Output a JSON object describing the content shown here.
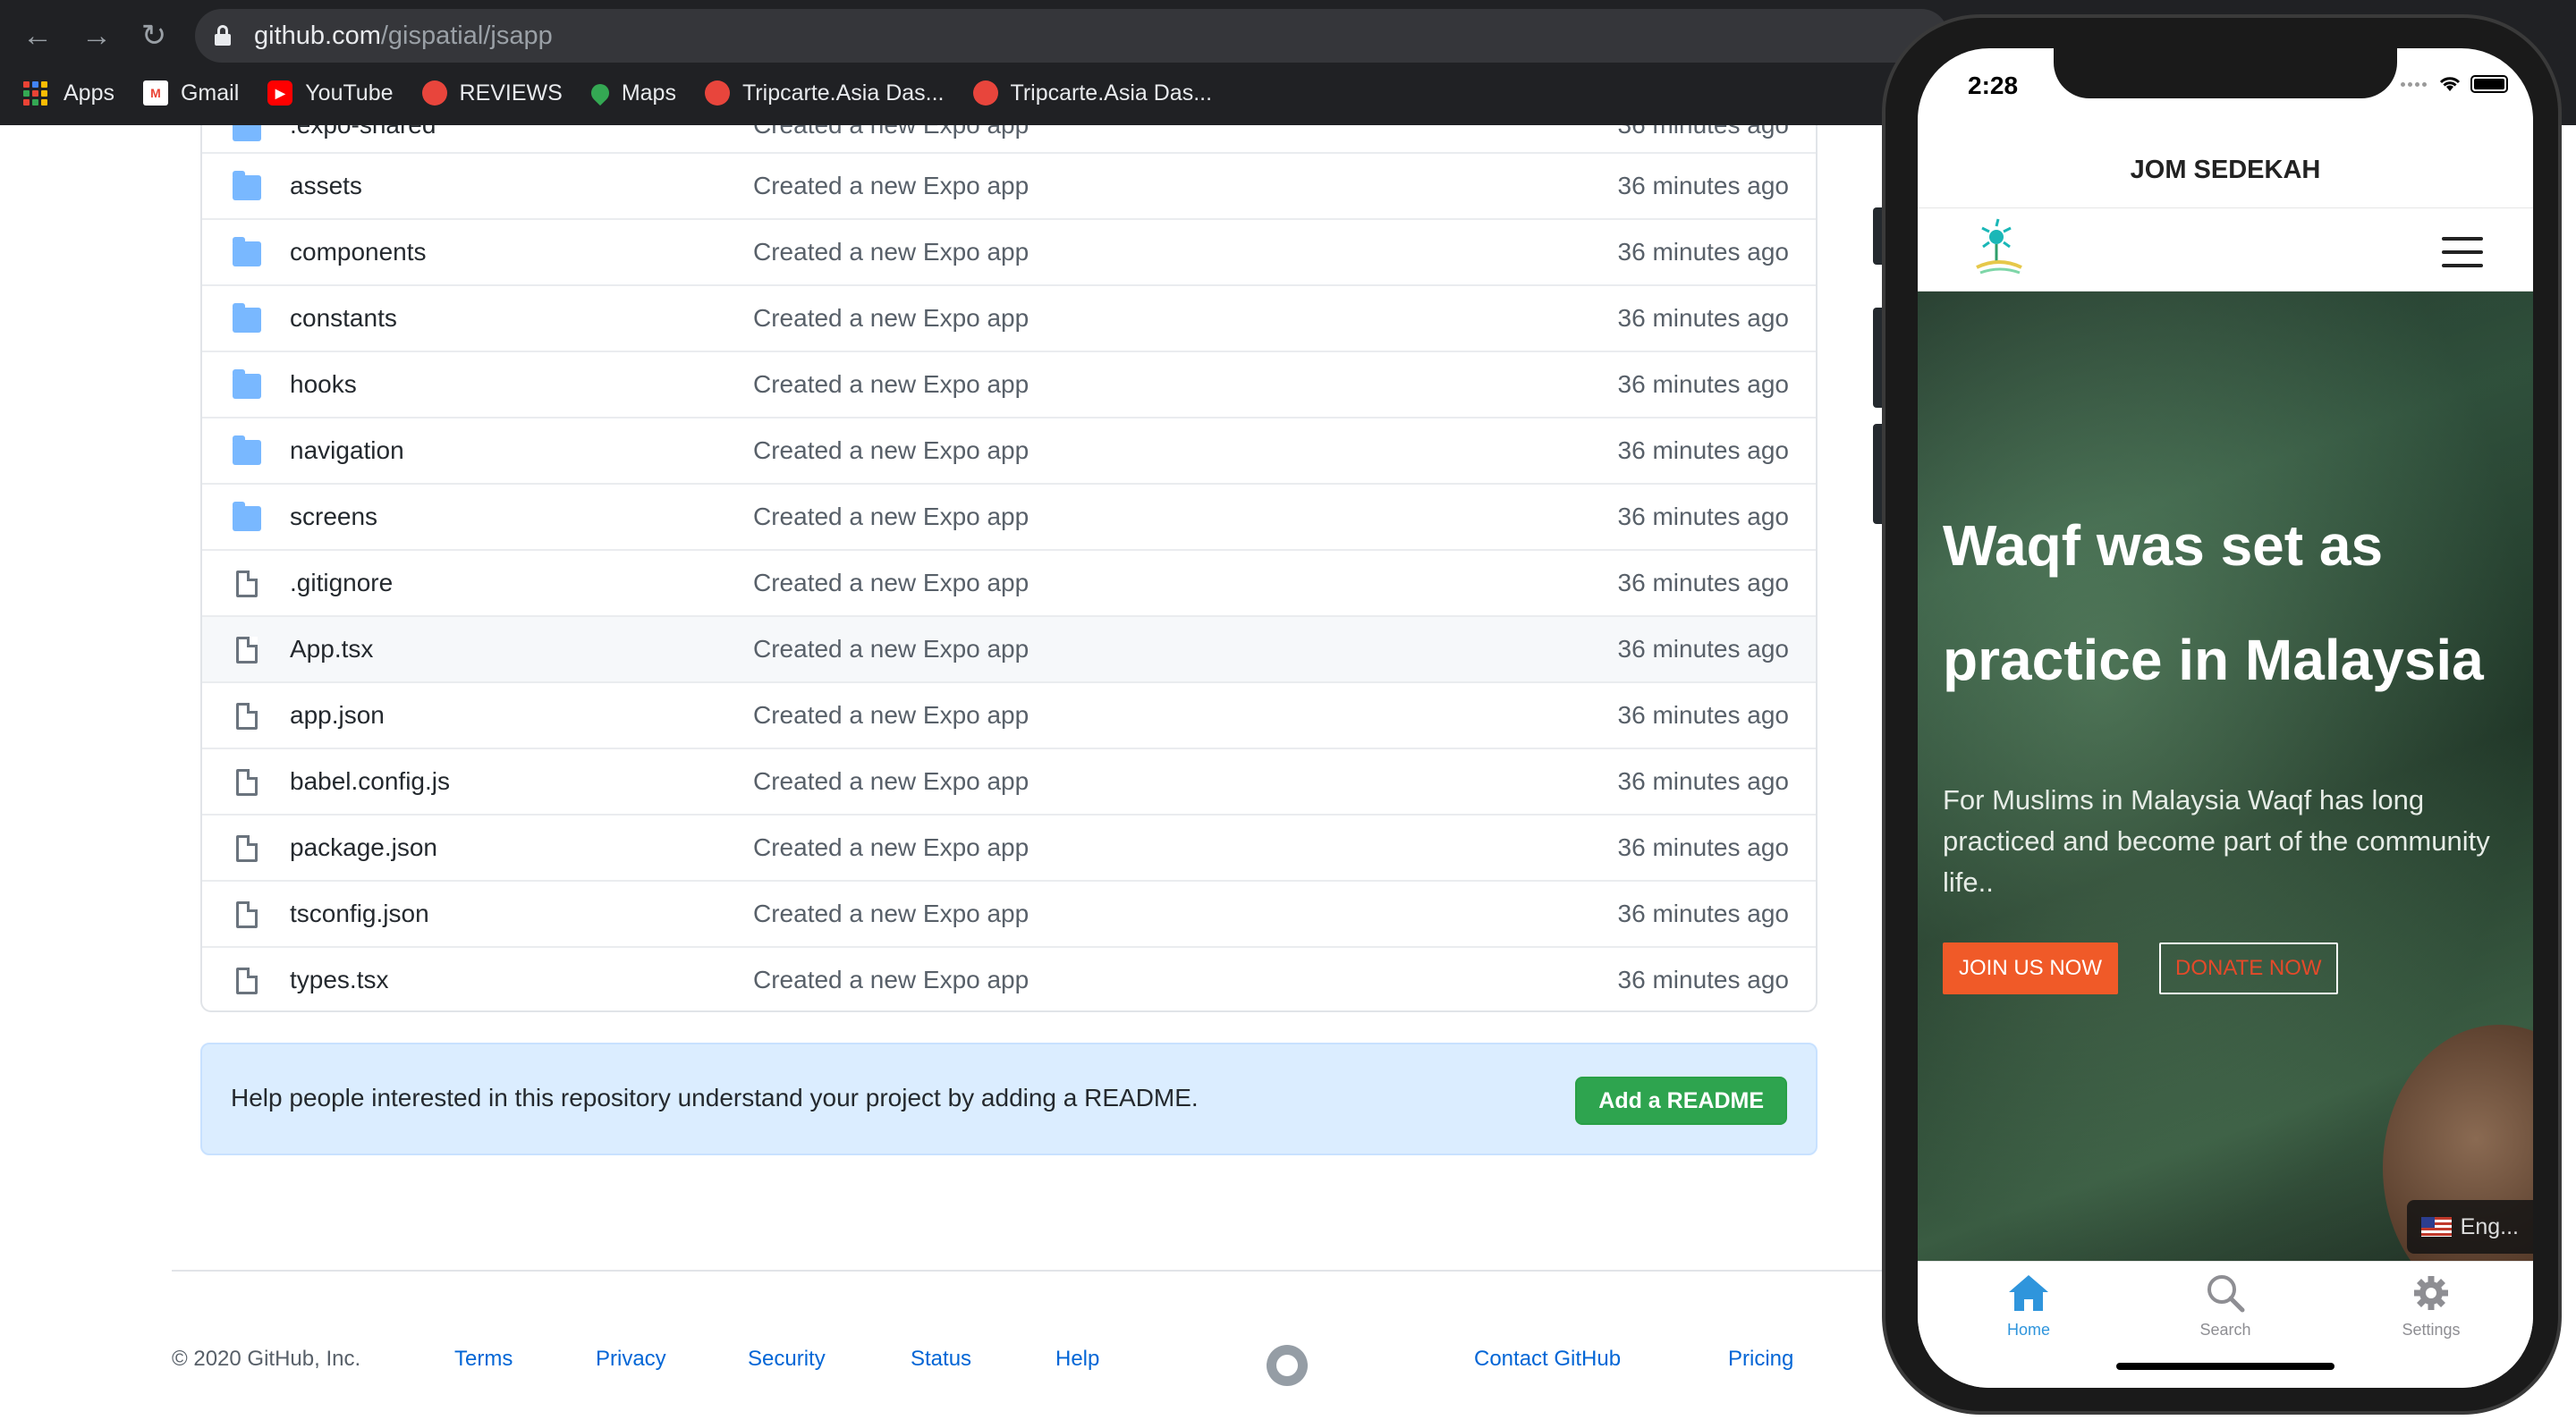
{
  "browser": {
    "url_host": "github.com",
    "url_path": "/gispatial/jsapp",
    "bookmarks": [
      {
        "label": "Apps",
        "icon": "apps-grid-icon"
      },
      {
        "label": "Gmail",
        "icon": "gmail-icon",
        "color": "#ea4335"
      },
      {
        "label": "YouTube",
        "icon": "youtube-icon",
        "color": "#ff0000"
      },
      {
        "label": "REVIEWS",
        "icon": "tripcarte-icon",
        "color": "#e8453c"
      },
      {
        "label": "Maps",
        "icon": "maps-icon",
        "color": "#34a853"
      },
      {
        "label": "Tripcarte.Asia Das...",
        "icon": "tripcarte-icon",
        "color": "#e8453c"
      },
      {
        "label": "Tripcarte.Asia Das...",
        "icon": "tripcarte-icon",
        "color": "#e8453c"
      }
    ]
  },
  "repo": {
    "partial_row": {
      "name": ".expo-shared",
      "message": "Created a new Expo app",
      "age": "36 minutes ago"
    },
    "files": [
      {
        "name": "assets",
        "type": "folder",
        "message": "Created a new Expo app",
        "age": "36 minutes ago"
      },
      {
        "name": "components",
        "type": "folder",
        "message": "Created a new Expo app",
        "age": "36 minutes ago"
      },
      {
        "name": "constants",
        "type": "folder",
        "message": "Created a new Expo app",
        "age": "36 minutes ago"
      },
      {
        "name": "hooks",
        "type": "folder",
        "message": "Created a new Expo app",
        "age": "36 minutes ago"
      },
      {
        "name": "navigation",
        "type": "folder",
        "message": "Created a new Expo app",
        "age": "36 minutes ago"
      },
      {
        "name": "screens",
        "type": "folder",
        "message": "Created a new Expo app",
        "age": "36 minutes ago"
      },
      {
        "name": ".gitignore",
        "type": "file",
        "message": "Created a new Expo app",
        "age": "36 minutes ago"
      },
      {
        "name": "App.tsx",
        "type": "file",
        "message": "Created a new Expo app",
        "age": "36 minutes ago"
      },
      {
        "name": "app.json",
        "type": "file",
        "message": "Created a new Expo app",
        "age": "36 minutes ago"
      },
      {
        "name": "babel.config.js",
        "type": "file",
        "message": "Created a new Expo app",
        "age": "36 minutes ago"
      },
      {
        "name": "package.json",
        "type": "file",
        "message": "Created a new Expo app",
        "age": "36 minutes ago"
      },
      {
        "name": "tsconfig.json",
        "type": "file",
        "message": "Created a new Expo app",
        "age": "36 minutes ago"
      },
      {
        "name": "types.tsx",
        "type": "file",
        "message": "Created a new Expo app",
        "age": "36 minutes ago"
      }
    ],
    "readme_prompt": "Help people interested in this repository understand your project by adding a README.",
    "readme_button": "Add a README"
  },
  "footer": {
    "copyright": "© 2020 GitHub, Inc.",
    "links": [
      "Terms",
      "Privacy",
      "Security",
      "Status",
      "Help",
      "Contact GitHub",
      "Pricing"
    ]
  },
  "phone": {
    "time": "2:28",
    "app_title": "JOM SEDEKAH",
    "hero_title": "Waqf was set as practice in Malaysia",
    "hero_text": "For Muslims in Malaysia Waqf has long practiced and become part of the community life..",
    "join_button": "JOIN US NOW",
    "donate_button": "DONATE NOW",
    "language": "Eng...",
    "tabs": [
      {
        "label": "Home",
        "icon": "home-icon",
        "active": true
      },
      {
        "label": "Search",
        "icon": "search-icon",
        "active": false
      },
      {
        "label": "Settings",
        "icon": "gear-icon",
        "active": false
      }
    ],
    "accent_color": "#2f95dc"
  }
}
